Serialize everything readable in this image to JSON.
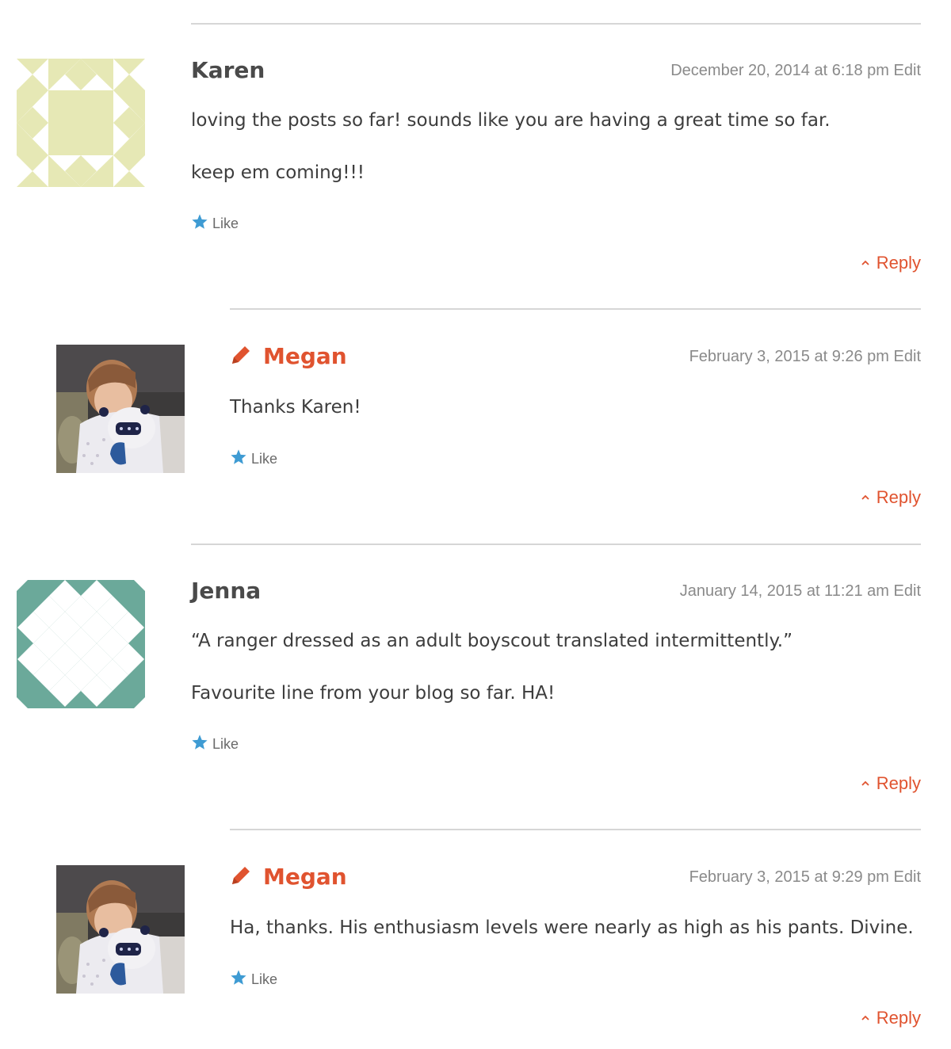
{
  "comments": [
    {
      "author": "Karen",
      "date": "December 20, 2014 at 6:18 pm",
      "edit": "Edit",
      "paragraphs": [
        "loving the posts so far! sounds like you are having a great time so far.",
        "keep em coming!!!"
      ],
      "like": "Like",
      "reply": "Reply",
      "avatar": "identicon-yellow"
    },
    {
      "author": "Megan",
      "date": "February 3, 2015 at 9:26 pm",
      "edit": "Edit",
      "paragraphs": [
        "Thanks Karen!"
      ],
      "like": "Like",
      "reply": "Reply",
      "avatar": "photo-avatar",
      "author_icon": "pencil-icon"
    },
    {
      "author": "Jenna",
      "date": "January 14, 2015 at 11:21 am",
      "edit": "Edit",
      "paragraphs": [
        "“A ranger dressed as an adult boyscout translated intermittently.”",
        "Favourite line from your blog so far. HA!"
      ],
      "like": "Like",
      "reply": "Reply",
      "avatar": "identicon-teal"
    },
    {
      "author": "Megan",
      "date": "February 3, 2015 at 9:29 pm",
      "edit": "Edit",
      "paragraphs": [
        "Ha, thanks. His enthusiasm levels were nearly as high as his pants. Divine."
      ],
      "like": "Like",
      "reply": "Reply",
      "avatar": "photo-avatar",
      "author_icon": "pencil-icon"
    }
  ],
  "colors": {
    "accent": "#e0532f",
    "star": "#3e9bd3",
    "identicon_yellow": "#e6e8b5",
    "identicon_teal": "#6ba99a",
    "divider": "#d6d6d6"
  }
}
